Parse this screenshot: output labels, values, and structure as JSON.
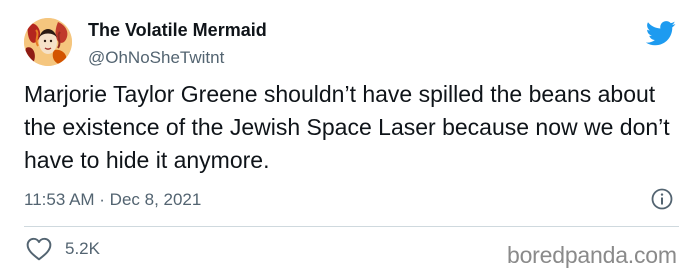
{
  "tweet": {
    "display_name": "The Volatile Mermaid",
    "handle": "@OhNoSheTwitnt",
    "text": "Marjorie Taylor Greene shouldn’t have spilled the beans about the existence of the Jewish Space Laser because now we don’t have to hide it anymore.",
    "timestamp": "11:53 AM · Dec 8, 2021",
    "like_count": "5.2K"
  },
  "icons": {
    "brand": "twitter-bird-icon",
    "info": "info-icon",
    "like": "heart-icon"
  },
  "watermark": "boredpanda.com",
  "colors": {
    "text": "#0f1419",
    "secondary": "#536471",
    "twitter_blue": "#1d9bf0",
    "divider": "#cfd9de"
  }
}
